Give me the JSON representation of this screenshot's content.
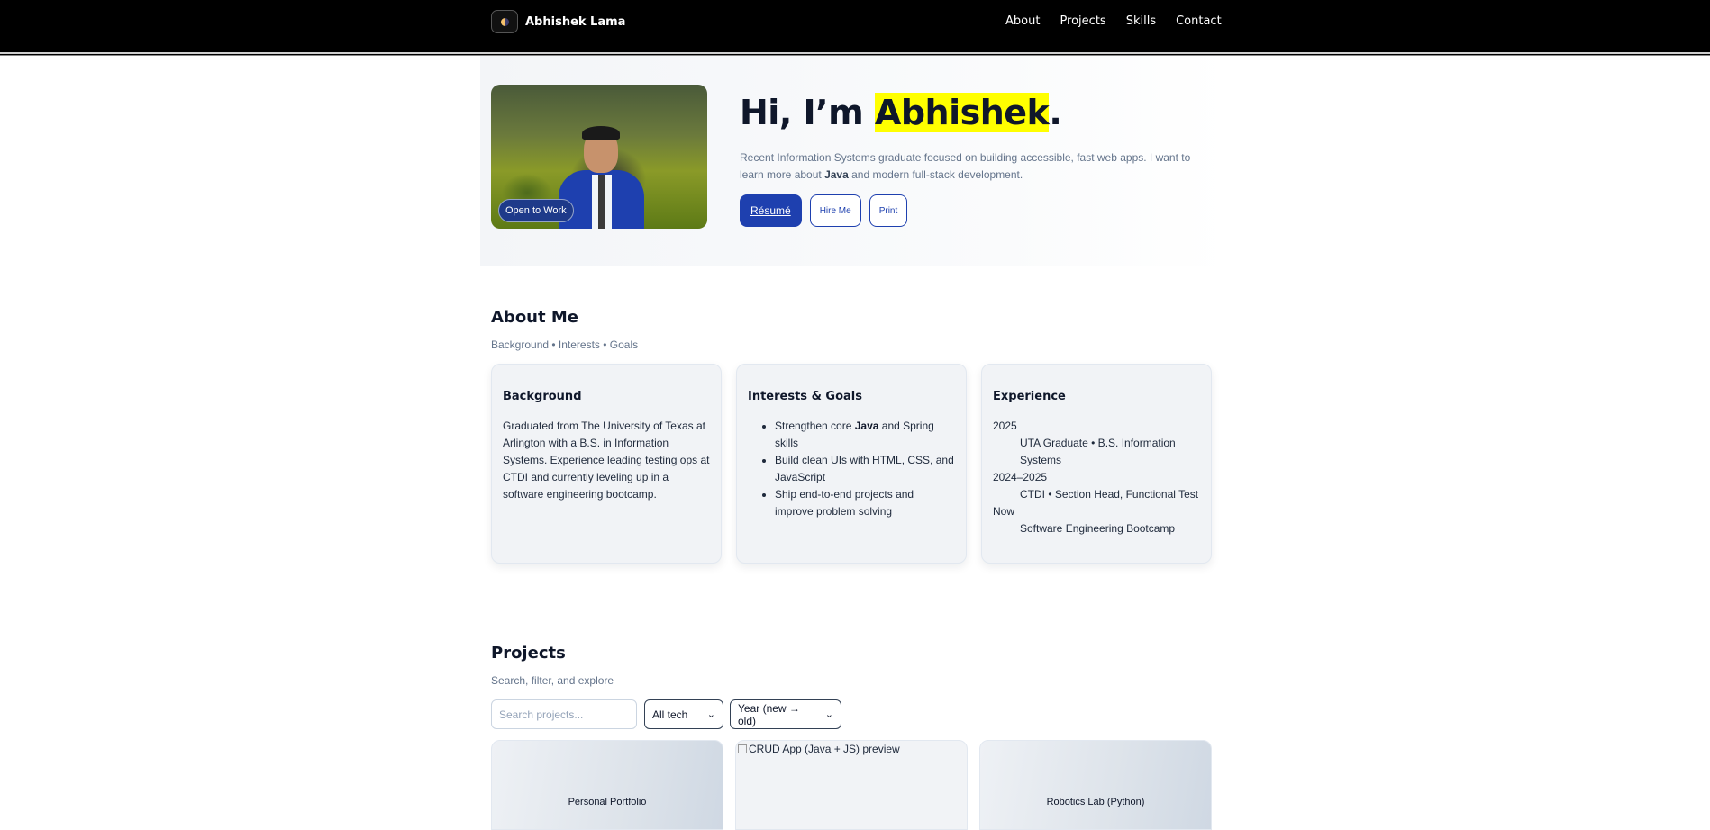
{
  "header": {
    "brand": "Abhishek Lama",
    "nav": [
      "About",
      "Projects",
      "Skills",
      "Contact"
    ]
  },
  "hero": {
    "badge": "Open to Work",
    "title_prefix": "Hi, I’m ",
    "title_name": "Abhishek",
    "title_suffix": ".",
    "desc_part1": "Recent Information Systems graduate focused on building accessible, fast web apps. I want to learn more about ",
    "desc_bold": "Java",
    "desc_part2": " and modern full-stack development.",
    "buttons": {
      "resume": "Résumé",
      "hire": "Hire Me",
      "print": "Print"
    },
    "highlight_color": "#ffff00"
  },
  "about": {
    "title": "About Me",
    "subtitle": "Background • Interests • Goals",
    "background": {
      "title": "Background",
      "text": "Graduated from The University of Texas at Arlington with a B.S. in Information Systems. Experience leading testing ops at CTDI and currently leveling up in a software engineering bootcamp."
    },
    "interests": {
      "title": "Interests & Goals",
      "items": [
        {
          "pre": "Strengthen core ",
          "bold": "Java",
          "post": " and Spring skills"
        },
        {
          "pre": "Build clean UIs with HTML, CSS, and JavaScript",
          "bold": "",
          "post": ""
        },
        {
          "pre": "Ship end-to-end projects and improve problem solving",
          "bold": "",
          "post": ""
        }
      ]
    },
    "experience": {
      "title": "Experience",
      "entries": [
        {
          "year": "2025",
          "item": "UTA Graduate • B.S. Information Systems"
        },
        {
          "year": "2024–2025",
          "item": "CTDI • Section Head, Functional Test"
        },
        {
          "year": "Now",
          "item": "Software Engineering Bootcamp"
        }
      ]
    }
  },
  "projects": {
    "title": "Projects",
    "subtitle": "Search, filter, and explore",
    "search_placeholder": "Search projects...",
    "tech_filter": "All tech",
    "sort": "Year (new → old)",
    "cards": [
      {
        "title": "Personal Portfolio"
      },
      {
        "alt": "CRUD App (Java + JS) preview"
      },
      {
        "title": "Robotics Lab (Python)"
      }
    ]
  },
  "colors": {
    "accent": "#1e40af",
    "header_bg": "#000000",
    "muted_text": "#64748b"
  }
}
